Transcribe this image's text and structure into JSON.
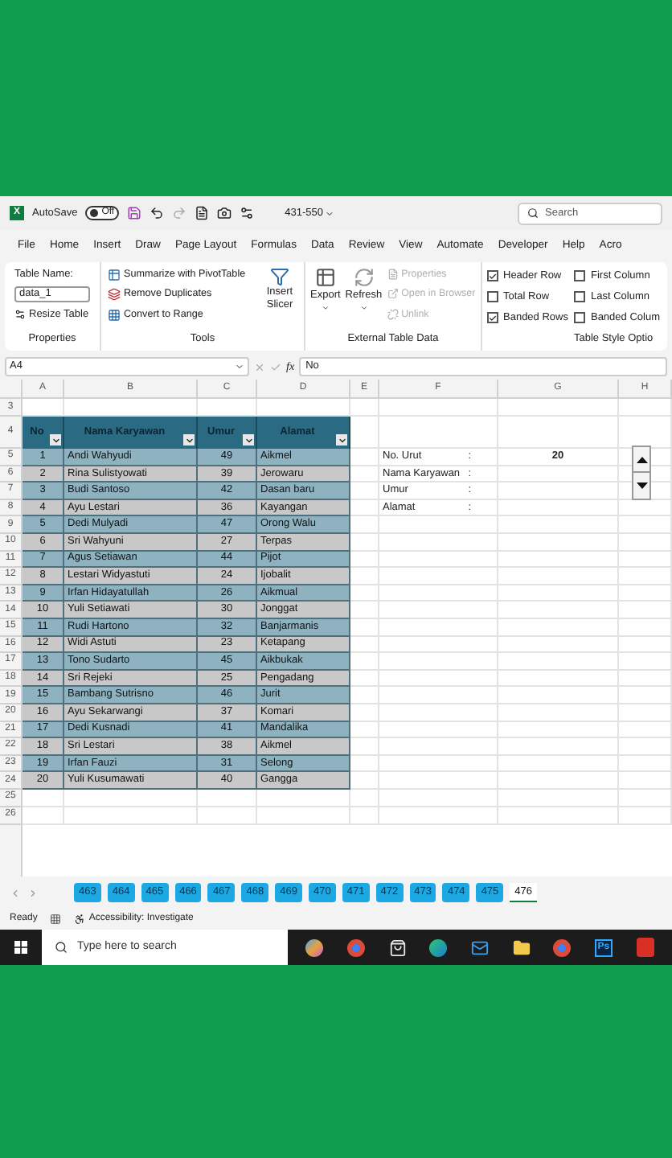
{
  "title_bar": {
    "app_badge": "X",
    "autosave_label": "AutoSave",
    "autosave": {
      "label": "Off",
      "on": false
    },
    "file_name": "431-550",
    "search_placeholder": "Search"
  },
  "menu": [
    {
      "label": "File",
      "selected": false
    },
    {
      "label": "Home",
      "selected": false
    },
    {
      "label": "Insert",
      "selected": false
    },
    {
      "label": "Draw",
      "selected": false
    },
    {
      "label": "Page Layout",
      "selected": false
    },
    {
      "label": "Formulas",
      "selected": false
    },
    {
      "label": "Data",
      "selected": false
    },
    {
      "label": "Review",
      "selected": false
    },
    {
      "label": "View",
      "selected": false
    },
    {
      "label": "Automate",
      "selected": false
    },
    {
      "label": "Developer",
      "selected": false
    },
    {
      "label": "Help",
      "selected": false
    },
    {
      "label": "Acro",
      "selected": false
    }
  ],
  "ribbon": {
    "properties": {
      "title": "Properties",
      "name_label": "Table Name:",
      "name_value": "data_1",
      "resize_button": "Resize Table"
    },
    "tools": {
      "title": "Tools",
      "buttons": [
        {
          "label": "Summarize with PivotTable",
          "kind": "pivot"
        },
        {
          "label": "Remove Duplicates",
          "kind": "dedupe"
        },
        {
          "label": "Convert to Range",
          "kind": "convert"
        }
      ],
      "slicer_button": "Insert Slicer"
    },
    "external": {
      "title": "External Table Data",
      "export_button": "Export",
      "refresh_button": "Refresh",
      "items": [
        {
          "label": "Properties",
          "disabled": true
        },
        {
          "label": "Open in Browser",
          "disabled": true
        },
        {
          "label": "Unlink",
          "disabled": true
        }
      ]
    },
    "style_options": {
      "title": "Table Style Optio",
      "options": [
        {
          "label": "Header Row",
          "checked": true
        },
        {
          "label": "Total Row",
          "checked": false
        },
        {
          "label": "Banded Rows",
          "checked": true
        },
        {
          "label": "First Column",
          "checked": false
        },
        {
          "label": "Last Column",
          "checked": false
        },
        {
          "label": "Banded Colum",
          "checked": false
        }
      ]
    }
  },
  "formula_bar": {
    "cell_ref": "A4",
    "fx_label": "fx",
    "formula": "No"
  },
  "columns": [
    "A",
    "B",
    "C",
    "D",
    "E",
    "F",
    "G",
    "H"
  ],
  "row_numbers": [
    "3",
    "4",
    "5",
    "6",
    "7",
    "8",
    "9",
    "10",
    "11",
    "12",
    "13",
    "14",
    "15",
    "16",
    "17",
    "18",
    "19",
    "20",
    "21",
    "22",
    "23",
    "24",
    "25",
    "26"
  ],
  "table": {
    "headers": [
      "No",
      "Nama Karyawan",
      "Umur",
      "Alamat"
    ],
    "rows": [
      [
        "1",
        "Andi Wahyudi",
        "49",
        "Aikmel"
      ],
      [
        "2",
        "Rina Sulistyowati",
        "39",
        "Jerowaru"
      ],
      [
        "3",
        "Budi Santoso",
        "42",
        "Dasan baru"
      ],
      [
        "4",
        "Ayu Lestari",
        "36",
        "Kayangan"
      ],
      [
        "5",
        "Dedi Mulyadi",
        "47",
        "Orong Walu"
      ],
      [
        "6",
        "Sri Wahyuni",
        "27",
        "Terpas"
      ],
      [
        "7",
        "Agus Setiawan",
        "44",
        "Pijot"
      ],
      [
        "8",
        "Lestari Widyastuti",
        "24",
        "Ijobalit"
      ],
      [
        "9",
        "Irfan Hidayatullah",
        "26",
        "Aikmual"
      ],
      [
        "10",
        "Yuli Setiawati",
        "30",
        "Jonggat"
      ],
      [
        "11",
        "Rudi Hartono",
        "32",
        "Banjarmanis"
      ],
      [
        "12",
        "Widi Astuti",
        "23",
        "Ketapang"
      ],
      [
        "13",
        "Tono Sudarto",
        "45",
        "Aikbukak"
      ],
      [
        "14",
        "Sri Rejeki",
        "25",
        "Pengadang"
      ],
      [
        "15",
        "Bambang Sutrisno",
        "46",
        "Jurit"
      ],
      [
        "16",
        "Ayu Sekarwangi",
        "37",
        "Komari"
      ],
      [
        "17",
        "Dedi Kusnadi",
        "41",
        "Mandalika"
      ],
      [
        "18",
        "Sri Lestari",
        "38",
        "Aikmel"
      ],
      [
        "19",
        "Irfan Fauzi",
        "31",
        "Selong"
      ],
      [
        "20",
        "Yuli Kusumawati",
        "40",
        "Gangga"
      ]
    ]
  },
  "form": {
    "fields": [
      {
        "label": "No. Urut",
        "colon": ":",
        "value": "20"
      },
      {
        "label": "Nama Karyawan",
        "colon": ":"
      },
      {
        "label": "Umur",
        "colon": ":"
      },
      {
        "label": "Alamat",
        "colon": ":"
      }
    ]
  },
  "sheet_tabs": [
    {
      "label": "463",
      "selected": false
    },
    {
      "label": "464",
      "selected": false
    },
    {
      "label": "465",
      "selected": false
    },
    {
      "label": "466",
      "selected": false
    },
    {
      "label": "467",
      "selected": false
    },
    {
      "label": "468",
      "selected": false
    },
    {
      "label": "469",
      "selected": false
    },
    {
      "label": "470",
      "selected": false
    },
    {
      "label": "471",
      "selected": false
    },
    {
      "label": "472",
      "selected": false
    },
    {
      "label": "473",
      "selected": false
    },
    {
      "label": "474",
      "selected": false
    },
    {
      "label": "475",
      "selected": false
    },
    {
      "label": "476",
      "selected": true
    }
  ],
  "status_bar": {
    "ready": "Ready",
    "accessibility": "Accessibility: Investigate"
  },
  "taskbar": {
    "search_placeholder": "Type here to search",
    "apps": [
      {
        "kind": "copilot"
      },
      {
        "kind": "chrome"
      },
      {
        "kind": "store"
      },
      {
        "kind": "edge"
      },
      {
        "kind": "mail"
      },
      {
        "kind": "folder"
      },
      {
        "kind": "chrome"
      },
      {
        "kind": "photoshop",
        "label": "Ps"
      },
      {
        "kind": "acrobat"
      }
    ]
  }
}
